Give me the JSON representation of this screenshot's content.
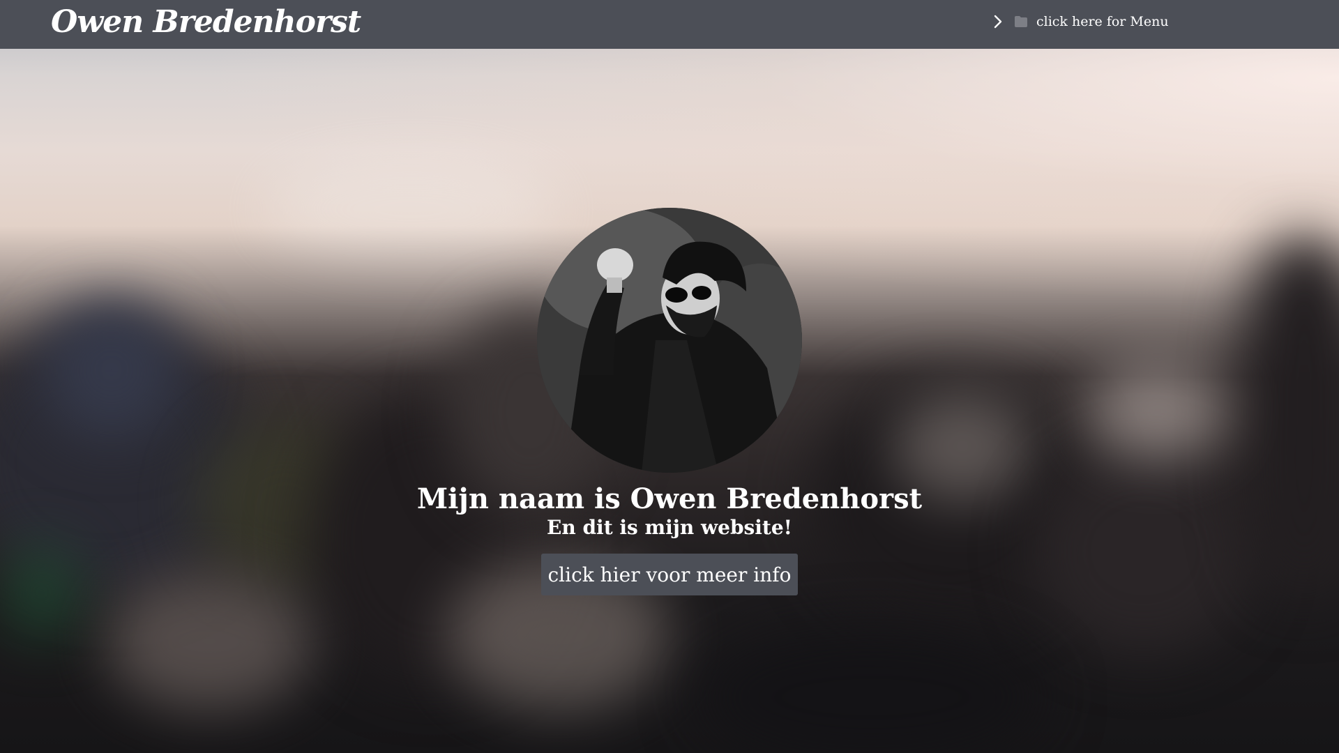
{
  "header": {
    "brand": "Owen Bredenhorst",
    "menu_label": "click here for Menu",
    "menu_icons": [
      "chevron-right-icon",
      "folder-icon"
    ],
    "background_color": "#4c4f57"
  },
  "hero": {
    "avatar": "profile-photo",
    "headline": "Mijn naam is Owen Bredenhorst",
    "subline": "En dit is mijn website!",
    "cta_label": "click hier voor meer info",
    "cta_color": "#4c4f57"
  },
  "theme": {
    "text_color": "#ffffff",
    "background": "blurred-city-skyline"
  }
}
